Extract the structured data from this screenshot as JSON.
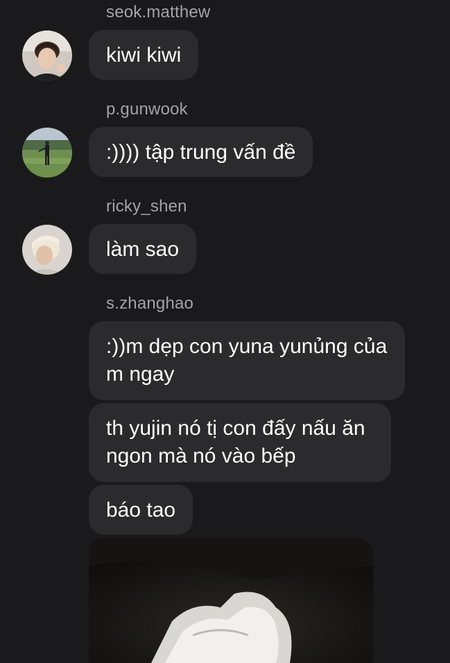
{
  "messages": [
    {
      "sender": "seok.matthew",
      "avatar": "avatar-seok-matthew",
      "bubbles": [
        "kiwi kiwi"
      ]
    },
    {
      "sender": "p.gunwook",
      "avatar": "avatar-p-gunwook",
      "bubbles": [
        ":)))) tập trung vấn đề"
      ]
    },
    {
      "sender": "ricky_shen",
      "avatar": "avatar-ricky-shen",
      "bubbles": [
        "làm sao"
      ]
    },
    {
      "sender": "s.zhanghao",
      "bubbles": [
        ":))m dẹp con yuna yunủng của m ngay",
        "th yujin nó tị con đấy nấu ăn ngon mà nó vào bếp",
        "báo tao"
      ]
    }
  ],
  "colors": {
    "background": "#1a1a1c",
    "bubble": "#2b2b2e",
    "sender_text": "#a3a3a8",
    "message_text": "#ffffff"
  }
}
